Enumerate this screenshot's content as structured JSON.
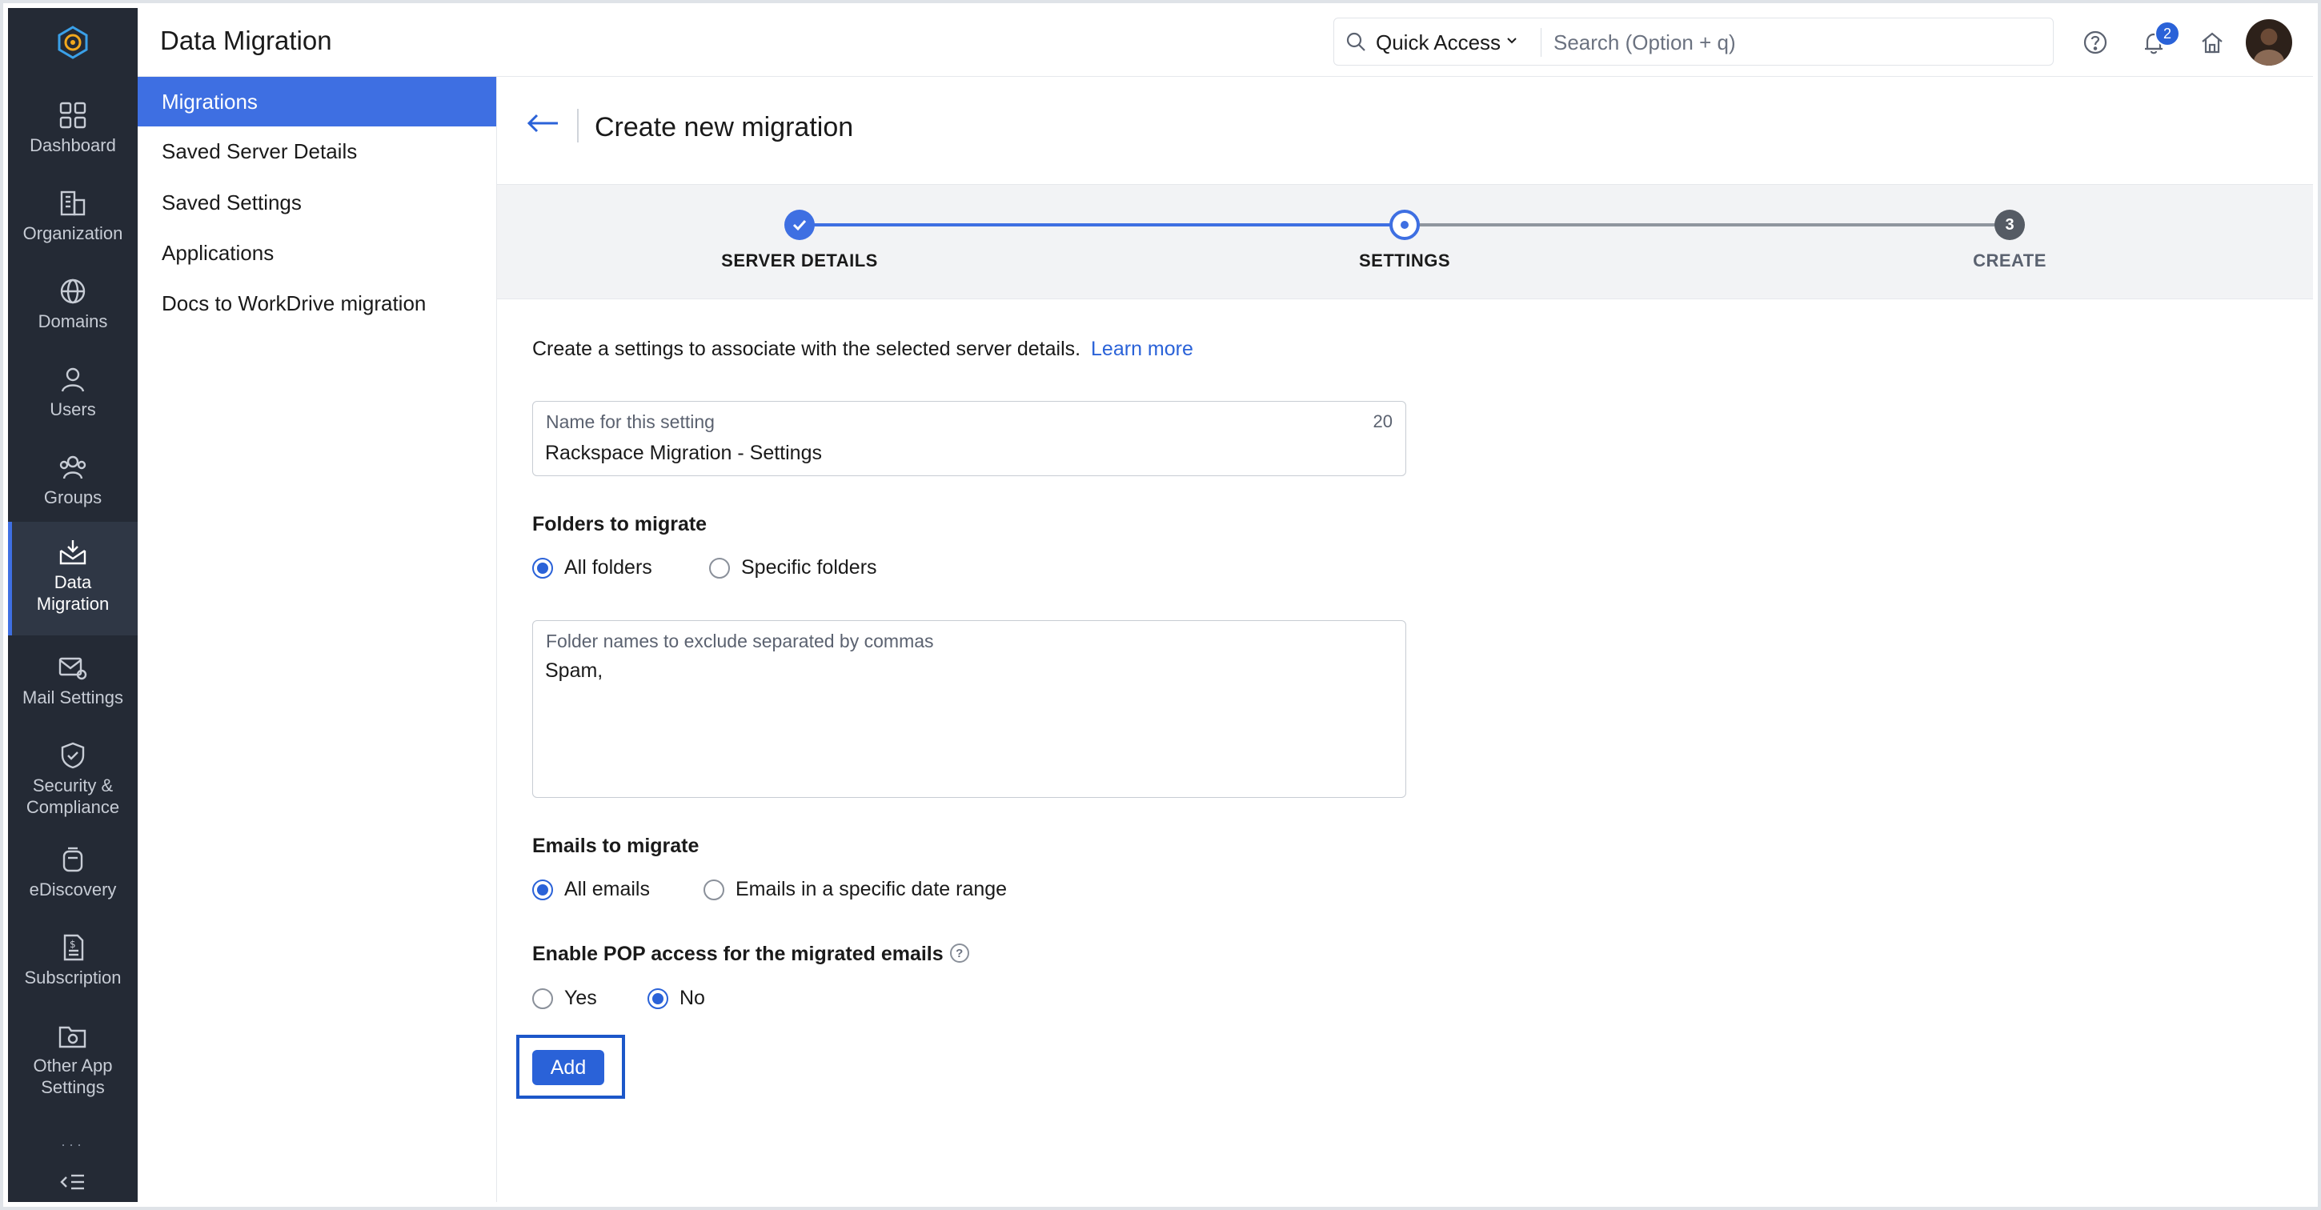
{
  "header": {
    "app_title": "Data Migration",
    "quick_access_label": "Quick Access",
    "search_placeholder": "Search (Option + q)",
    "notification_count": "2"
  },
  "rail": {
    "items": [
      {
        "label": "Dashboard",
        "icon": "dashboard-icon"
      },
      {
        "label": "Organization",
        "icon": "organization-icon"
      },
      {
        "label": "Domains",
        "icon": "globe-icon"
      },
      {
        "label": "Users",
        "icon": "user-icon"
      },
      {
        "label": "Groups",
        "icon": "groups-icon"
      },
      {
        "label_1": "Data",
        "label_2": "Migration",
        "icon": "data-migration-icon",
        "active": true
      },
      {
        "label": "Mail Settings",
        "icon": "mail-settings-icon"
      },
      {
        "label_1": "Security &",
        "label_2": "Compliance",
        "icon": "shield-icon"
      },
      {
        "label": "eDiscovery",
        "icon": "ediscovery-icon"
      },
      {
        "label": "Subscription",
        "icon": "subscription-icon"
      },
      {
        "label_1": "Other App",
        "label_2": "Settings",
        "icon": "other-app-settings-icon"
      }
    ]
  },
  "subnav": {
    "items": [
      "Migrations",
      "Saved Server Details",
      "Saved Settings",
      "Applications",
      "Docs to WorkDrive migration"
    ],
    "active_index": 0
  },
  "page": {
    "title": "Create new migration",
    "steps": [
      {
        "label": "SERVER DETAILS",
        "state": "done"
      },
      {
        "label": "SETTINGS",
        "state": "current"
      },
      {
        "label": "CREATE",
        "number": "3",
        "state": "pending"
      }
    ],
    "intro_text": "Create a settings to associate with the selected server details.",
    "learn_more": "Learn more",
    "setting_name": {
      "label": "Name for this setting",
      "counter": "20",
      "value": "Rackspace Migration - Settings"
    },
    "folders": {
      "heading": "Folders to migrate",
      "options": [
        "All folders",
        "Specific folders"
      ],
      "selected": "All folders",
      "exclude_label": "Folder names to exclude separated by commas",
      "exclude_value": "Spam,"
    },
    "emails": {
      "heading": "Emails to migrate",
      "options": [
        "All emails",
        "Emails in a specific date range"
      ],
      "selected": "All emails"
    },
    "pop": {
      "heading": "Enable POP access for the migrated emails",
      "options": [
        "Yes",
        "No"
      ],
      "selected": "No"
    },
    "add_button": "Add"
  },
  "colors": {
    "rail_bg": "#242a35",
    "accent": "#2a62d8",
    "active_nav": "#3e6fe2",
    "stepper_bg": "#f2f3f5"
  }
}
